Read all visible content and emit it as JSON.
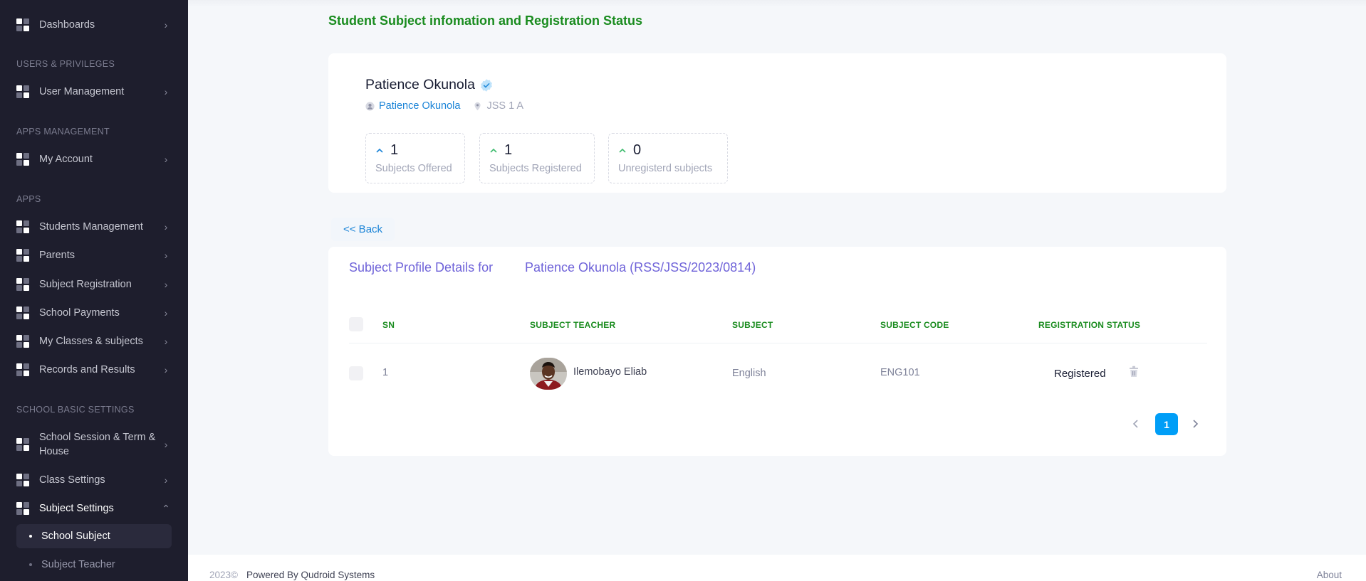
{
  "sidebar": {
    "items": [
      {
        "label": "Dashboards"
      },
      {
        "label": "User Management"
      },
      {
        "label": "My Account"
      },
      {
        "label": "Students Management"
      },
      {
        "label": "Parents"
      },
      {
        "label": "Subject Registration"
      },
      {
        "label": "School Payments"
      },
      {
        "label": "My Classes & subjects"
      },
      {
        "label": "Records and Results"
      },
      {
        "label": "School Session & Term & House"
      },
      {
        "label": "Class Settings"
      },
      {
        "label": "Subject Settings"
      }
    ],
    "sections": [
      "USERS & PRIVILEGES",
      "APPS MANAGEMENT",
      "APPS",
      "SCHOOL BASIC SETTINGS"
    ],
    "subitems": [
      {
        "label": "School Subject",
        "active": true
      },
      {
        "label": "Subject Teacher",
        "active": false
      }
    ]
  },
  "page": {
    "heading": "Student Subject infomation and Registration Status"
  },
  "profile": {
    "name": "Patience Okunola",
    "link_name": "Patience Okunola",
    "class": "JSS 1 A",
    "stats": [
      {
        "value": "1",
        "caption": "Subjects Offered"
      },
      {
        "value": "1",
        "caption": "Subjects Registered"
      },
      {
        "value": "0",
        "caption": "Unregisterd subjects"
      }
    ]
  },
  "back_label": "<< Back",
  "details": {
    "title": "Subject Profile Details for",
    "student": "Patience Okunola (RSS/JSS/2023/0814)",
    "columns": [
      "SN",
      "SUBJECT TEACHER",
      "SUBJECT",
      "SUBJECT CODE",
      "REGISTRATION STATUS"
    ],
    "rows": [
      {
        "sn": "1",
        "teacher": "Ilemobayo Eliab",
        "subject": "English",
        "code": "ENG101",
        "status": "Registered"
      }
    ],
    "pagination": {
      "current": "1"
    }
  },
  "footer": {
    "year": "2023©",
    "powered": "Powered By Qudroid Systems",
    "about": "About"
  },
  "colors": {
    "sidebar_bg": "#1e1e2d",
    "heading_green": "#1a8c1f",
    "accent_purple": "#6f63d9",
    "link_blue": "#1b84d7",
    "primary_blue": "#009ef7"
  }
}
